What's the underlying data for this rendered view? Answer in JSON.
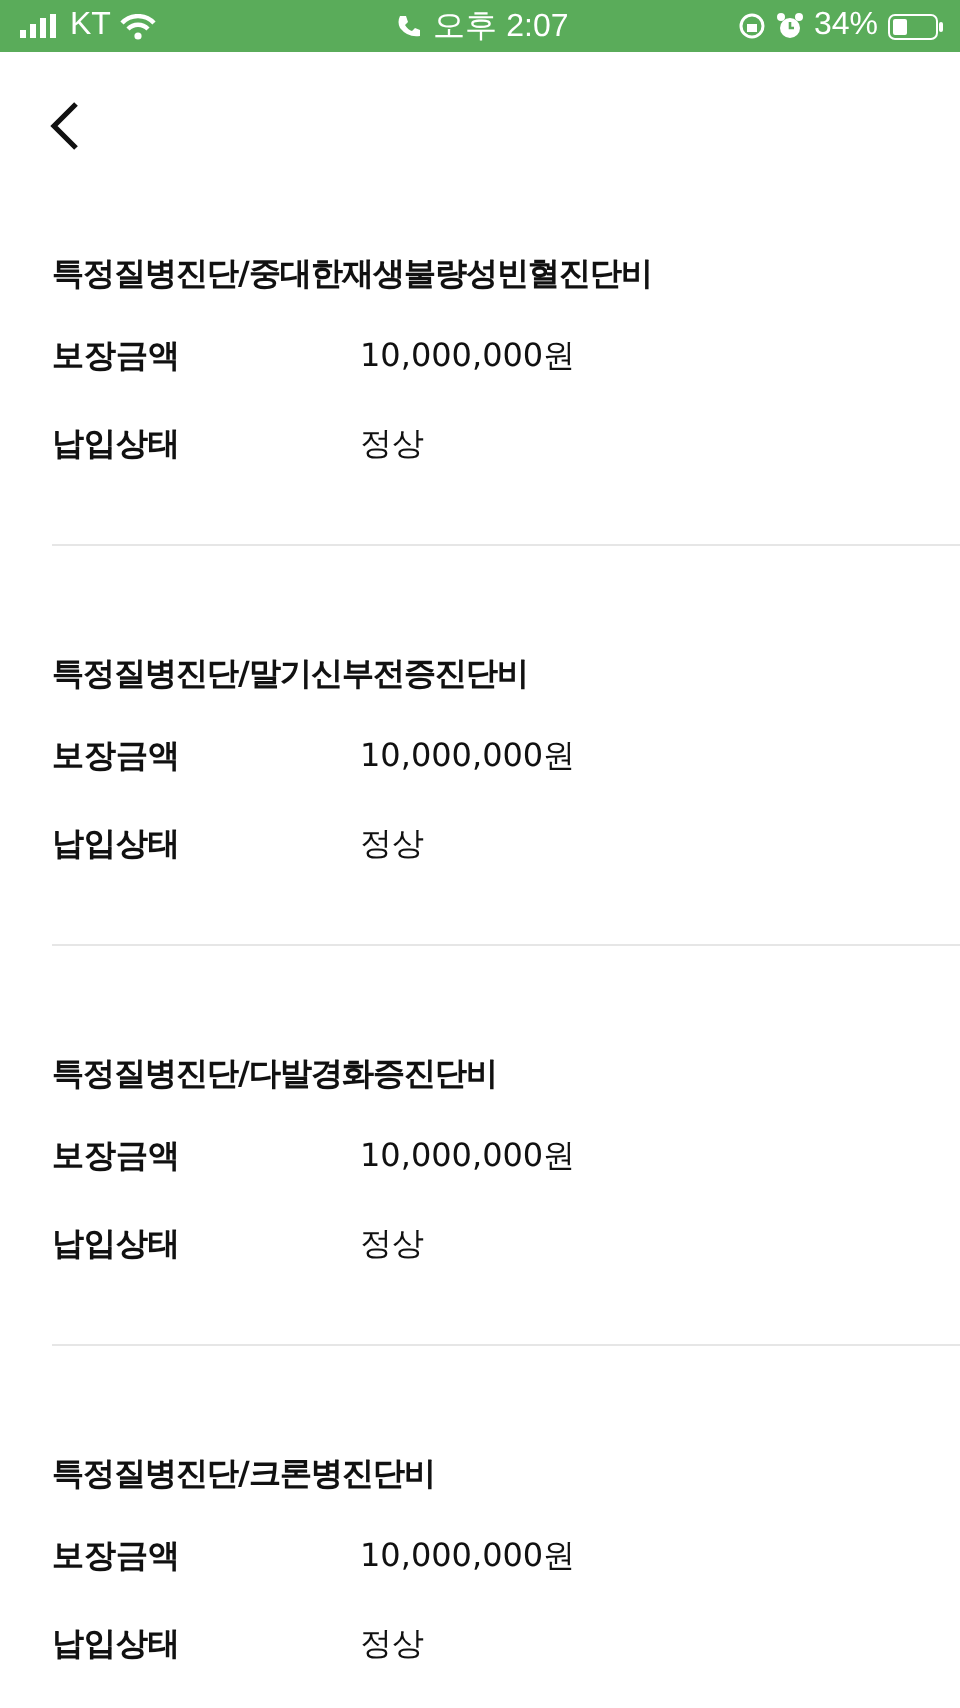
{
  "status_bar": {
    "carrier": "KT",
    "time": "오후 2:07",
    "battery": "34%"
  },
  "sections": [
    {
      "title": "특정질병진단/중대한재생불량성빈혈진단비",
      "rows": [
        {
          "label": "보장금액",
          "value": "10,000,000원"
        },
        {
          "label": "납입상태",
          "value": "정상"
        }
      ]
    },
    {
      "title": "특정질병진단/말기신부전증진단비",
      "rows": [
        {
          "label": "보장금액",
          "value": "10,000,000원"
        },
        {
          "label": "납입상태",
          "value": "정상"
        }
      ]
    },
    {
      "title": "특정질병진단/다발경화증진단비",
      "rows": [
        {
          "label": "보장금액",
          "value": "10,000,000원"
        },
        {
          "label": "납입상태",
          "value": "정상"
        }
      ]
    },
    {
      "title": "특정질병진단/크론병진단비",
      "rows": [
        {
          "label": "보장금액",
          "value": "10,000,000원"
        },
        {
          "label": "납입상태",
          "value": "정상"
        }
      ]
    }
  ]
}
